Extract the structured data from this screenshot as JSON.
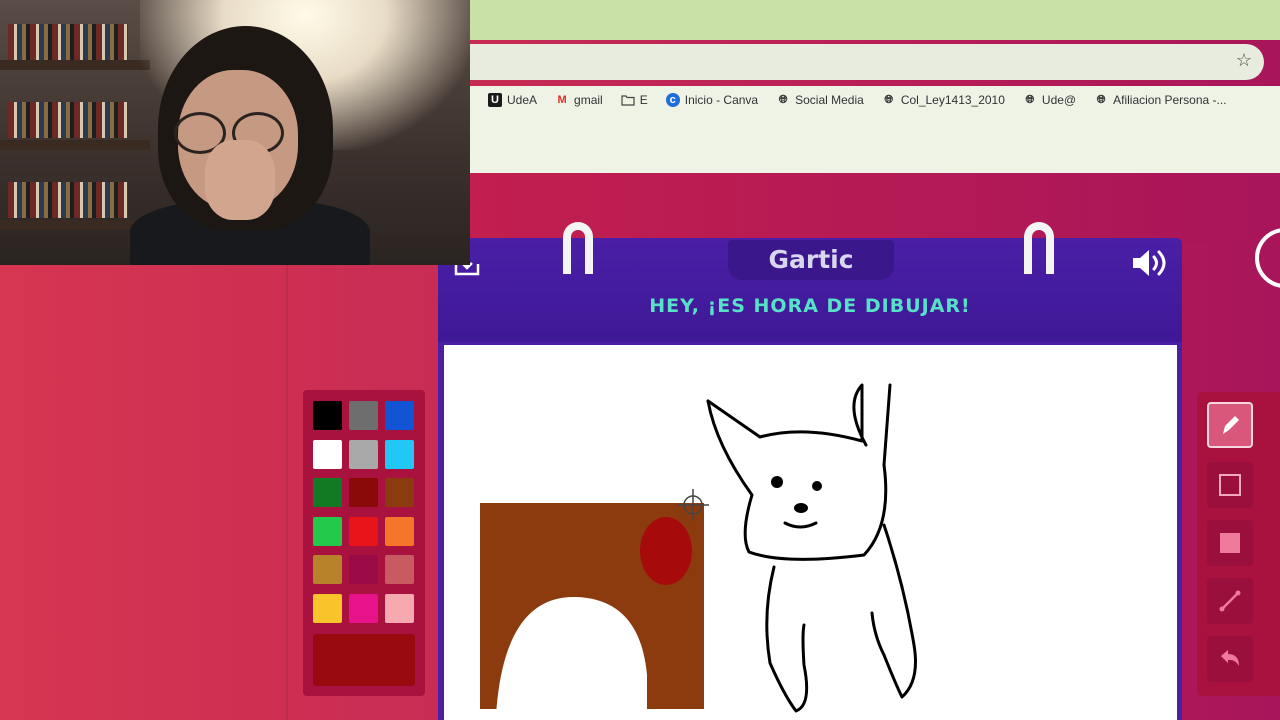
{
  "browser": {
    "bookmarks": [
      {
        "label": "UdeA",
        "icon": "udea-icon"
      },
      {
        "label": "gmail",
        "icon": "gmail-icon"
      },
      {
        "label": "E",
        "icon": "folder-icon"
      },
      {
        "label": "Inicio - Canva",
        "icon": "canva-icon"
      },
      {
        "label": "Social Media",
        "icon": "globe-icon"
      },
      {
        "label": "Col_Ley1413_2010",
        "icon": "globe-icon"
      },
      {
        "label": "Ude@",
        "icon": "globe-icon"
      },
      {
        "label": "Afiliacion Persona -...",
        "icon": "globe-icon"
      }
    ]
  },
  "game": {
    "logo": "Gartic",
    "headline": "HEY, ¡ES HORA DE DIBUJAR!",
    "current_color": "#990a10",
    "palette_colors": [
      "#000000",
      "#6e6e6e",
      "#1155d4",
      "#ffffff",
      "#a9a9a9",
      "#22c8f5",
      "#127a22",
      "#8a0a0a",
      "#8c3b0f",
      "#23c94a",
      "#e8141a",
      "#f5762a",
      "#b8822a",
      "#990a47",
      "#c85a62",
      "#f8c42a",
      "#e8138a",
      "#f7a9b0"
    ],
    "tools": [
      {
        "name": "pen",
        "icon": "pen-icon",
        "selected": true
      },
      {
        "name": "rectangle-outline",
        "icon": "square-outline-icon",
        "selected": false
      },
      {
        "name": "rectangle-filled",
        "icon": "square-filled-icon",
        "selected": false
      },
      {
        "name": "line",
        "icon": "line-icon",
        "selected": false
      },
      {
        "name": "undo",
        "icon": "undo-icon",
        "selected": false
      }
    ]
  }
}
